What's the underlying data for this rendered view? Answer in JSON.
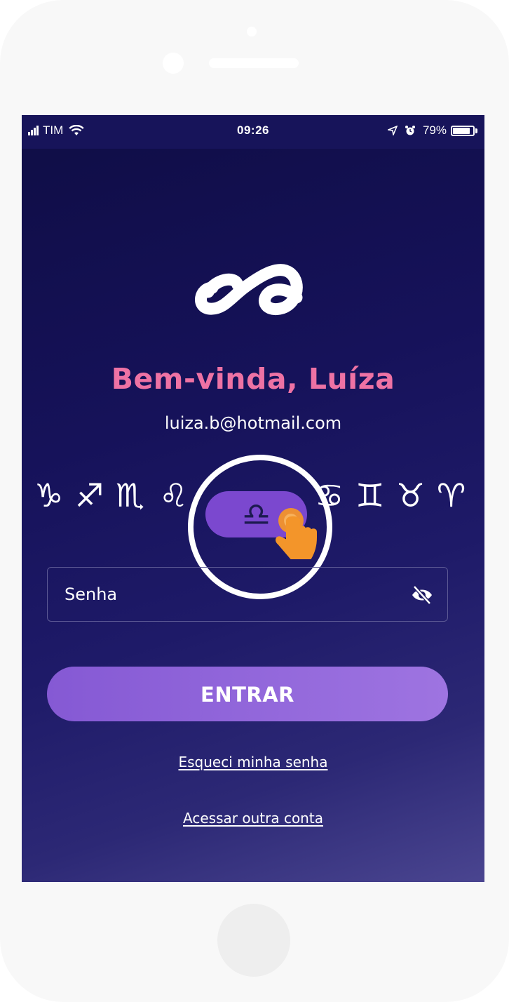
{
  "statusbar": {
    "carrier": "TIM",
    "time": "09:26",
    "battery": "79%",
    "icons": [
      "signal-bars-icon",
      "wifi-icon",
      "location-arrow-icon",
      "alarm-clock-icon",
      "battery-icon"
    ]
  },
  "logo": {
    "icon": "ea-logo-icon"
  },
  "welcome": {
    "title": "Bem-vinda, Luíza",
    "email": "luiza.b@hotmail.com"
  },
  "zodiac": {
    "signs_left": [
      "♑",
      "♐",
      "♏",
      "♌"
    ],
    "selected": "♎",
    "signs_right": [
      "♋",
      "♊",
      "♉",
      "♈"
    ]
  },
  "password": {
    "label": "Senha",
    "icon": "eye-slash-icon"
  },
  "actions": {
    "enter": "ENTRAR",
    "forgot": "Esqueci minha senha",
    "other_account": "Acessar outra conta"
  },
  "colors": {
    "accent_pink": "#ee72a4",
    "button_purple": "#8559d4",
    "pill_purple": "#7b48cf",
    "background_navy": "#16125a",
    "tap_hand": "#f3952a"
  }
}
